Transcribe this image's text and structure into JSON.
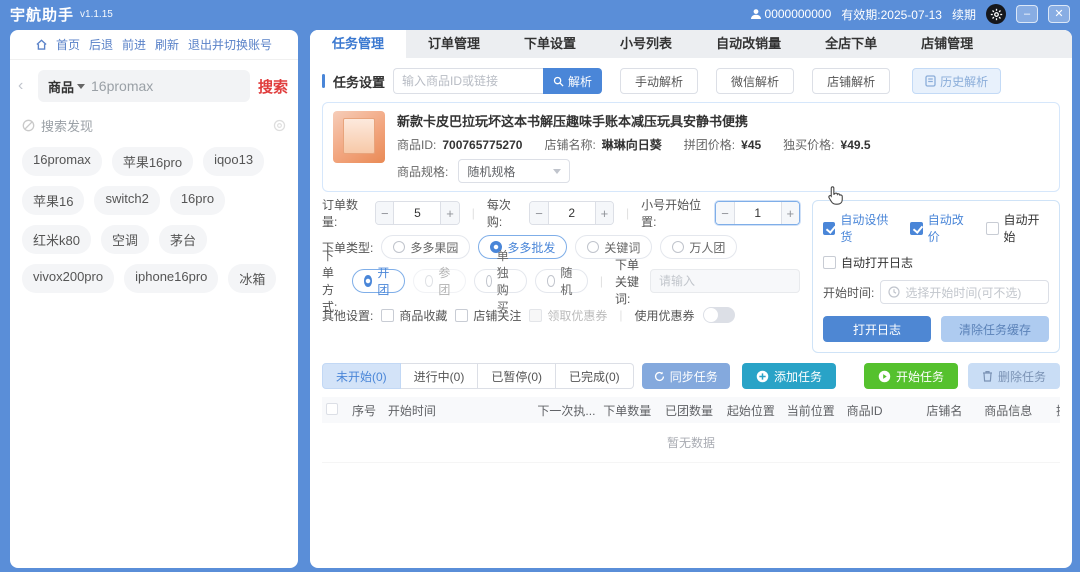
{
  "colors": {
    "background": "#5a8ed8",
    "accent": "#4a86d8",
    "search_red": "#e03c3c",
    "start_green": "#55c12e",
    "add_teal": "#29a3c7"
  },
  "titlebar": {
    "app": "宇航助手",
    "version": "v1.1.15",
    "account": "0000000000",
    "validity": "有效期:2025-07-13",
    "renew": "续期",
    "minimize": "–",
    "close": "✕"
  },
  "sidebar": {
    "nav": {
      "home": "首页",
      "back": "后退",
      "forward": "前进",
      "refresh": "刷新",
      "logout": "退出并切换账号"
    },
    "search": {
      "category": "商品",
      "query": "16promax",
      "button": "搜索"
    },
    "discover": "搜索发现",
    "tags": [
      "16promax",
      "苹果16pro",
      "iqoo13",
      "苹果16",
      "switch2",
      "16pro",
      "红米k80",
      "空调",
      "茅台",
      "vivox200pro",
      "iphone16pro",
      "冰箱"
    ]
  },
  "tabs": {
    "items": [
      {
        "label": "任务管理"
      },
      {
        "label": "订单管理"
      },
      {
        "label": "下单设置"
      },
      {
        "label": "小号列表"
      },
      {
        "label": "自动改销量"
      },
      {
        "label": "全店下单"
      },
      {
        "label": "店铺管理"
      }
    ]
  },
  "task_setting": {
    "label": "任务设置",
    "placeholder": "输入商品ID或链接",
    "parse": "解析",
    "manual": "手动解析",
    "wechat": "微信解析",
    "shop": "店铺解析",
    "history": "历史解析"
  },
  "product": {
    "title": "新款卡皮巴拉玩坏这本书解压趣味手账本减压玩具安静书便携",
    "id_label": "商品ID:",
    "id": "700765775270",
    "shop_label": "店铺名称:",
    "shop": "琳琳向日葵",
    "group_label": "拼团价格:",
    "group_price": "¥45",
    "single_label": "独买价格:",
    "single_price": "¥49.5",
    "spec_label": "商品规格:",
    "spec": "随机规格"
  },
  "form": {
    "qty_label": "订单数量:",
    "qty": "5",
    "per_label": "每次购:",
    "per": "2",
    "pos_label": "小号开始位置:",
    "pos": "1",
    "type_label": "下单类型:",
    "type_options": [
      {
        "label": "多多果园"
      },
      {
        "label": "多多批发"
      },
      {
        "label": "关键词"
      },
      {
        "label": "万人团"
      }
    ],
    "method_label": "下单方式:",
    "method_options": [
      {
        "label": "开团"
      },
      {
        "label": "参团"
      },
      {
        "label": "单独购买"
      },
      {
        "label": "随机"
      }
    ],
    "keyword_label": "下单关键词:",
    "keyword_placeholder": "请输入",
    "other_label": "其他设置:",
    "other_options": [
      {
        "label": "商品收藏"
      },
      {
        "label": "店铺关注"
      },
      {
        "label": "领取优惠券"
      }
    ],
    "coupon_label": "使用优惠券"
  },
  "auto": {
    "supply": "自动设供货",
    "reprice": "自动改价",
    "autostart": "自动开始",
    "autolog": "自动打开日志",
    "time_label": "开始时间:",
    "time_placeholder": "选择开始时间(可不选)",
    "open_log": "打开日志",
    "clear_cache": "清除任务缓存"
  },
  "taskbar": {
    "status": [
      {
        "label": "未开始(0)"
      },
      {
        "label": "进行中(0)"
      },
      {
        "label": "已暂停(0)"
      },
      {
        "label": "已完成(0)"
      }
    ],
    "sync": "同步任务",
    "add": "添加任务",
    "start": "开始任务",
    "delete": "删除任务"
  },
  "table": {
    "headers": [
      "序号",
      "开始时间",
      "下一次执...",
      "下单数量",
      "已团数量",
      "起始位置",
      "当前位置",
      "商品ID",
      "店铺名",
      "商品信息",
      "操作"
    ],
    "empty": "暂无数据"
  }
}
